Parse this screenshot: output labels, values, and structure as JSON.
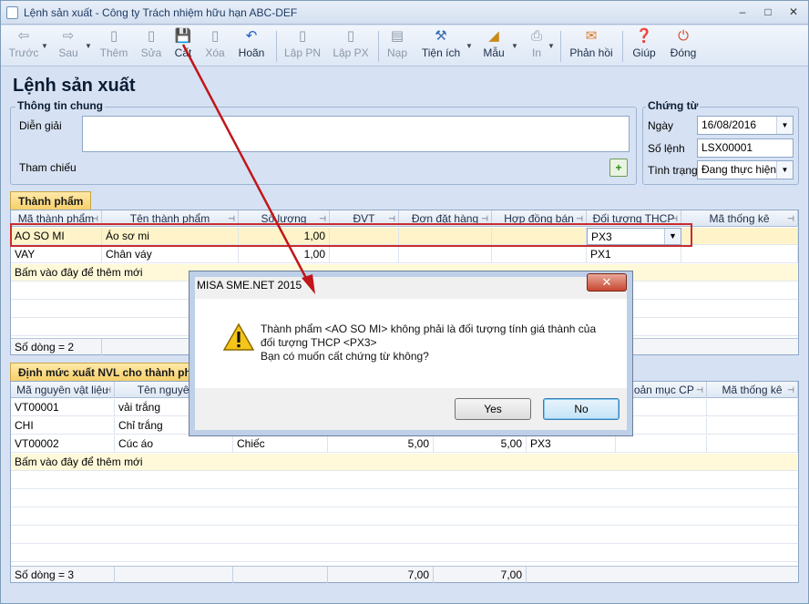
{
  "window": {
    "title": "Lệnh sản xuất - Công ty Trách nhiệm hữu hạn ABC-DEF"
  },
  "toolbar": {
    "prev": "Trước",
    "next": "Sau",
    "add": "Thêm",
    "edit": "Sửa",
    "save": "Cất",
    "delete": "Xóa",
    "undo": "Hoãn",
    "make_pn": "Lập PN",
    "make_px": "Lập PX",
    "load": "Nạp",
    "utility": "Tiện ích",
    "template": "Mẫu",
    "print": "In",
    "feedback": "Phản hồi",
    "help": "Giúp",
    "close": "Đóng"
  },
  "page_title": "Lệnh sản xuất",
  "general": {
    "legend": "Thông tin chung",
    "desc_label": "Diễn giải",
    "desc_value": "",
    "ref_label": "Tham chiếu"
  },
  "voucher": {
    "legend": "Chứng từ",
    "date_label": "Ngày",
    "date_value": "16/08/2016",
    "number_label": "Số lệnh",
    "number_value": "LSX00001",
    "status_label": "Tình trạng",
    "status_value": "Đang thực hiện"
  },
  "products": {
    "tab": "Thành phẩm",
    "columns": [
      "Mã thành phẩm",
      "Tên thành phẩm",
      "Số lượng",
      "ĐVT",
      "Đơn đặt hàng",
      "Hợp đồng bán",
      "Đối tượng THCP",
      "Mã thống kê"
    ],
    "rows": [
      {
        "code": "AO SO MI",
        "name": "Áo sơ mi",
        "qty": "1,00",
        "unit": "",
        "order": "",
        "contract": "",
        "cost_obj": "PX3",
        "stat": ""
      },
      {
        "code": "VAY",
        "name": "Chân váy",
        "qty": "1,00",
        "unit": "",
        "order": "",
        "contract": "",
        "cost_obj": "PX1",
        "stat": ""
      }
    ],
    "add_row": "Bấm vào đây để thêm mới",
    "footer": "Số dòng = 2"
  },
  "materials": {
    "tab": "Định mức xuất NVL cho thành phẩm",
    "columns": [
      "Mã nguyên vật liệu",
      "Tên nguyên vật liệu",
      "",
      "",
      "",
      "",
      "Khoản mục CP",
      "Mã thống kê"
    ],
    "col_labels_visible": {
      "c3": "Tên nguyên vậ",
      "c7": "hoản mục CP"
    },
    "rows": [
      {
        "code": "VT00001",
        "name": "vải trắng",
        "unit": "",
        "q1": "",
        "q2": "",
        "obj": ""
      },
      {
        "code": "CHI",
        "name": "Chỉ trắng",
        "unit": "",
        "q1": "",
        "q2": "",
        "obj": ""
      },
      {
        "code": "VT00002",
        "name": "Cúc áo",
        "unit": "Chiếc",
        "q1": "5,00",
        "q2": "5,00",
        "obj": "PX3"
      }
    ],
    "add_row": "Bấm vào đây để thêm mới",
    "footer": "Số dòng = 3",
    "footer_q1": "7,00",
    "footer_q2": "7,00"
  },
  "dialog": {
    "title": "MISA SME.NET 2015",
    "line1": "Thành phẩm <AO SO MI> không phải là đối tượng tính giá thành của",
    "line2": "đối tượng THCP <PX3>",
    "line3": "Bạn có muốn cất chứng từ không?",
    "yes": "Yes",
    "no": "No"
  },
  "colors": {
    "highlight": "#c82d2d",
    "accent": "#f6cf6b"
  }
}
